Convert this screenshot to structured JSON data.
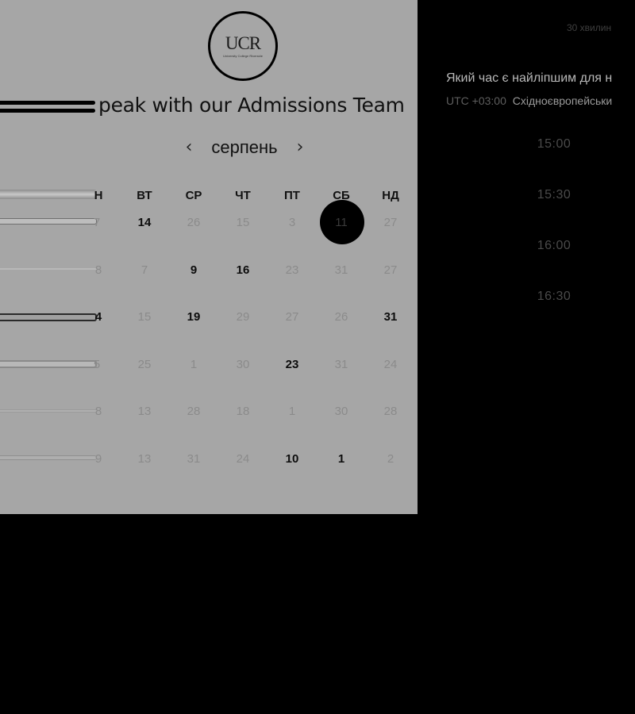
{
  "logo": {
    "mark": "UCR",
    "subtitle": "University College Riverside"
  },
  "title": "peak with our Admissions Team",
  "calendar": {
    "month": "серпень",
    "prev_icon": "chevron-left-icon",
    "next_icon": "chevron-right-icon",
    "weekdays": [
      "Н",
      "ВТ",
      "СР",
      "ЧТ",
      "ПТ",
      "СБ",
      "НД"
    ],
    "rows": [
      [
        {
          "text": "7",
          "bold": false,
          "partial": true
        },
        {
          "text": "14",
          "bold": true
        },
        {
          "text": "26",
          "bold": false
        },
        {
          "text": "15",
          "bold": false
        },
        {
          "text": "3",
          "bold": false
        },
        {
          "text": "11",
          "bold": false,
          "selected": true
        },
        {
          "text": "27",
          "bold": false
        }
      ],
      [
        {
          "text": "8",
          "bold": false
        },
        {
          "text": "7",
          "bold": false
        },
        {
          "text": "9",
          "bold": true
        },
        {
          "text": "16",
          "bold": true
        },
        {
          "text": "23",
          "bold": false
        },
        {
          "text": "31",
          "bold": false
        },
        {
          "text": "27",
          "bold": false
        }
      ],
      [
        {
          "text": "4",
          "bold": true
        },
        {
          "text": "15",
          "bold": false
        },
        {
          "text": "19",
          "bold": true
        },
        {
          "text": "29",
          "bold": false
        },
        {
          "text": "27",
          "bold": false
        },
        {
          "text": "26",
          "bold": false
        },
        {
          "text": "31",
          "bold": true
        }
      ],
      [
        {
          "text": "5",
          "bold": false,
          "partial": true
        },
        {
          "text": "25",
          "bold": false
        },
        {
          "text": "1",
          "bold": false
        },
        {
          "text": "30",
          "bold": false
        },
        {
          "text": "23",
          "bold": true
        },
        {
          "text": "31",
          "bold": false
        },
        {
          "text": "24",
          "bold": false
        }
      ],
      [
        {
          "text": "8",
          "bold": false
        },
        {
          "text": "13",
          "bold": false
        },
        {
          "text": "28",
          "bold": false
        },
        {
          "text": "18",
          "bold": false
        },
        {
          "text": "1",
          "bold": false
        },
        {
          "text": "30",
          "bold": false
        },
        {
          "text": "28",
          "bold": false
        }
      ],
      [
        {
          "text": "9",
          "bold": false
        },
        {
          "text": "13",
          "bold": false
        },
        {
          "text": "31",
          "bold": false
        },
        {
          "text": "24",
          "bold": false
        },
        {
          "text": "10",
          "bold": true
        },
        {
          "text": "1",
          "bold": true
        },
        {
          "text": "2",
          "bold": false
        }
      ]
    ]
  },
  "booking": {
    "duration": "30 хвилин",
    "question": "Який час є найліпшим для н",
    "timezone_code": "UTC +03:00",
    "timezone_name": "Східноєвропейськи",
    "slots": [
      "15:00",
      "15:30",
      "16:00",
      "16:30"
    ]
  },
  "colors": {
    "panel_bg": "#a6a6a6",
    "page_bg": "#000000",
    "selected_day": "#000000"
  }
}
